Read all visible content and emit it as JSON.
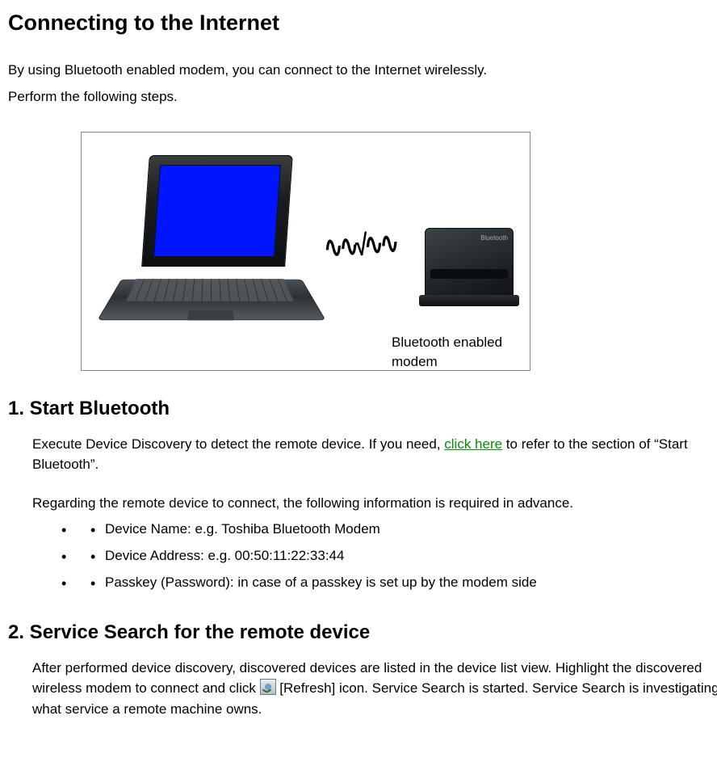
{
  "title": "Connecting to the Internet",
  "intro1": "By using Bluetooth enabled modem, you can connect to the Internet wirelessly.",
  "intro2": "Perform the following steps.",
  "figure": {
    "caption": "Bluetooth enabled modem",
    "modem_brand": "Bluetooth"
  },
  "step1": {
    "number_heading": "1. Start Bluetooth",
    "p1_before_link": "Execute Device Discovery to detect the remote device.  If you need, ",
    "link": "click here",
    "p1_after_link": " to refer to the section of “Start Bluetooth”.",
    "p2": "Regarding the remote device to connect, the following information is required in advance.",
    "bullets": [
      "Device Name: e.g. Toshiba Bluetooth Modem",
      "Device Address: e.g. 00:50:11:22:33:44",
      "Passkey (Password): in case of a passkey is set up by the modem side"
    ]
  },
  "step2": {
    "number_heading": "2.  Service Search for the remote device",
    "p_before_icon": "After performed device discovery, discovered devices are listed in the device list view. Highlight the discovered wireless modem to connect and click ",
    "p_after_icon": " [Refresh] icon. Service Search is started. Service Search is investigating what service a remote machine owns."
  }
}
